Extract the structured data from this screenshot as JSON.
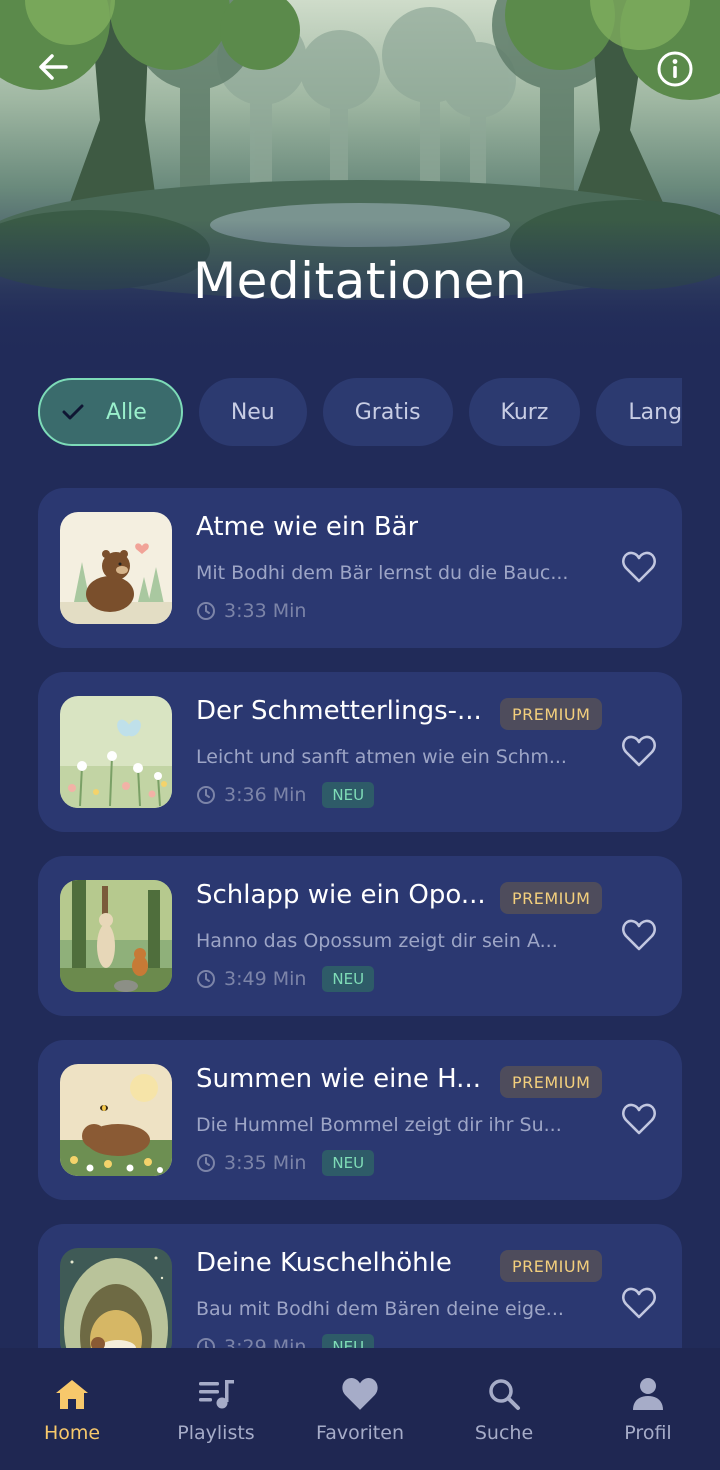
{
  "header": {
    "title": "Meditationen",
    "back_icon": "arrow-left-icon",
    "info_icon": "info-circle-icon"
  },
  "filters": [
    {
      "label": "Alle",
      "active": true,
      "icon": "check-icon"
    },
    {
      "label": "Neu",
      "active": false
    },
    {
      "label": "Gratis",
      "active": false
    },
    {
      "label": "Kurz",
      "active": false
    },
    {
      "label": "Lang",
      "active": false
    }
  ],
  "meditations": [
    {
      "title": "Atme wie ein Bär",
      "description": "Mit Bodhi dem Bär lernst du die Bauc...",
      "duration": "3:33 Min",
      "premium": "",
      "new": "",
      "thumbnail": "bear-forest"
    },
    {
      "title": "Der Schmetterlings-...",
      "description": "Leicht und sanft atmen wie ein Schm...",
      "duration": "3:36 Min",
      "premium": "PREMIUM",
      "new": "NEU",
      "thumbnail": "butterfly-meadow"
    },
    {
      "title": "Schlapp wie ein Opo...",
      "description": "Hanno das Opossum zeigt dir sein A...",
      "duration": "3:49 Min",
      "premium": "PREMIUM",
      "new": "NEU",
      "thumbnail": "opossum-forest"
    },
    {
      "title": "Summen wie eine H...",
      "description": "Die Hummel Bommel zeigt dir ihr Su...",
      "duration": "3:35 Min",
      "premium": "PREMIUM",
      "new": "NEU",
      "thumbnail": "bumblebee-bear"
    },
    {
      "title": "Deine Kuschelhöhle",
      "description": "Bau mit Bodhi dem Bären deine eige...",
      "duration": "3:29 Min",
      "premium": "PREMIUM",
      "new": "NEU",
      "thumbnail": "cozy-cave"
    }
  ],
  "nav": {
    "home": "Home",
    "playlists": "Playlists",
    "favorites": "Favoriten",
    "search": "Suche",
    "profile": "Profil"
  },
  "colors": {
    "background": "#212b59",
    "card": "#2b3871",
    "accent_green": "#7ddbb8",
    "accent_gold": "#f7c86b",
    "premium_text": "#f3cf7d"
  }
}
